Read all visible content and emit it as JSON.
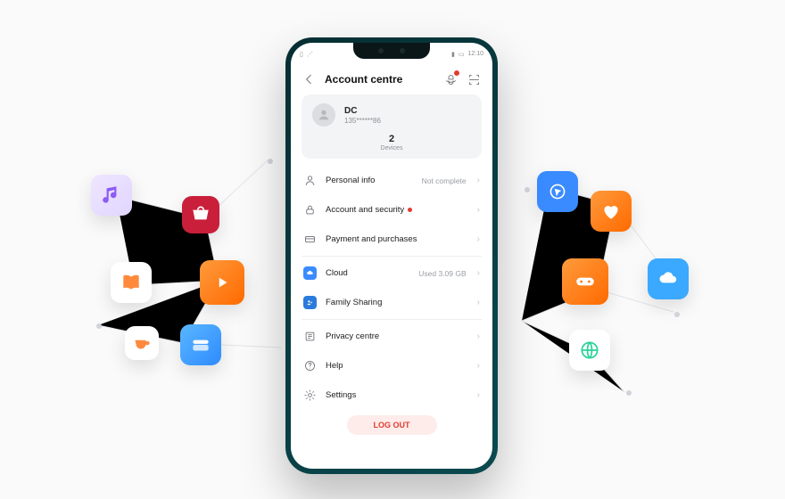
{
  "status": {
    "time": "12:10"
  },
  "header": {
    "title": "Account centre"
  },
  "profile": {
    "name": "DC",
    "phone": "135******86",
    "device_count": "2",
    "devices_label": "Devices"
  },
  "sections": [
    {
      "label": "Personal info",
      "meta": "Not complete",
      "icon": "person"
    },
    {
      "label": "Account and security",
      "red_dot": true,
      "icon": "lock"
    },
    {
      "label": "Payment and purchases",
      "icon": "card"
    },
    {
      "label": "Cloud",
      "meta": "Used 3.09 GB",
      "icon": "cloud",
      "color": "#3a8bff"
    },
    {
      "label": "Family Sharing",
      "icon": "family",
      "color": "#2b7bdc"
    },
    {
      "label": "Privacy centre",
      "icon": "privacy"
    },
    {
      "label": "Help",
      "icon": "help"
    },
    {
      "label": "Settings",
      "icon": "gear"
    }
  ],
  "logout": "LOG OUT",
  "floating_icons": [
    "music-icon",
    "appgallery-icon",
    "books-icon",
    "video-icon",
    "coffee-icon",
    "wallet-icon",
    "browser-icon",
    "health-icon",
    "gamecenter-icon",
    "cloud-icon",
    "globe-icon"
  ]
}
